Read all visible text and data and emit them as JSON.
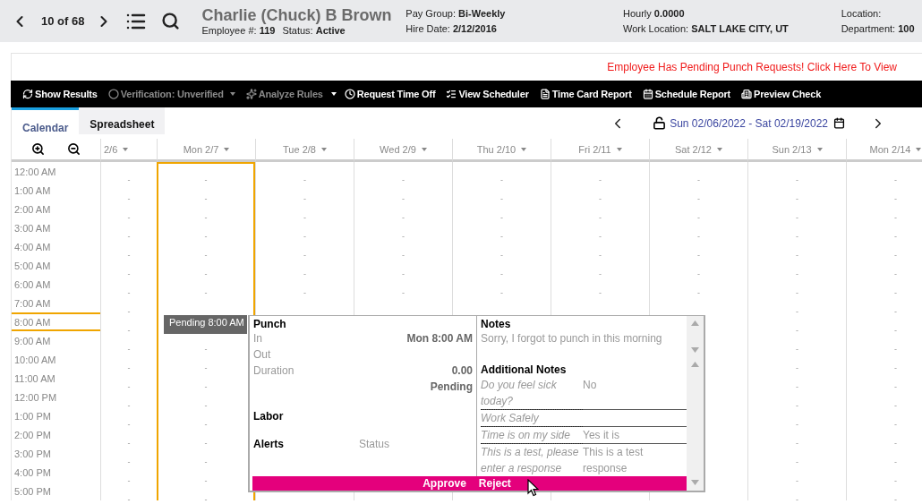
{
  "header": {
    "position": "10 of 68",
    "employee_name": "Charlie (Chuck) B Brown",
    "employee_number_label": "Employee #:",
    "employee_number": "119",
    "status_label": "Status:",
    "status": "Active",
    "field_groups": [
      [
        {
          "label": "Pay Group:",
          "value": "Bi-Weekly"
        },
        {
          "label": "Hire Date:",
          "value": "2/12/2016"
        }
      ],
      [
        {
          "label": "Hourly",
          "value": "0.0000"
        },
        {
          "label": "Work Location:",
          "value": "SALT LAKE CITY, UT"
        }
      ],
      [
        {
          "label": "Location:"
        },
        {
          "label": "Department:",
          "value": "100"
        }
      ]
    ]
  },
  "alert_link": "Employee Has Pending Punch Requests! Click Here To View",
  "toolbar": [
    {
      "kind": "button",
      "label": "Show Results",
      "disabled": false
    },
    {
      "kind": "dropdown",
      "label": "Verification: Unverified",
      "disabled": true
    },
    {
      "kind": "button",
      "label": "Analyze Rules",
      "disabled": true
    },
    {
      "kind": "caret",
      "disabled": false
    },
    {
      "kind": "button",
      "label": "Request Time Off",
      "disabled": false
    },
    {
      "kind": "button",
      "label": "View Scheduler",
      "disabled": false
    },
    {
      "kind": "button",
      "label": "Time Card Report",
      "disabled": false
    },
    {
      "kind": "button",
      "label": "Schedule Report",
      "disabled": false
    },
    {
      "kind": "button",
      "label": "Preview Check",
      "disabled": false
    }
  ],
  "tabs": [
    {
      "label": "Calendar",
      "selected": true
    },
    {
      "label": "Spreadsheet",
      "selected": false
    }
  ],
  "date_range": "Sun 02/06/2022 - Sat 02/19/2022",
  "days": [
    {
      "label": "2/6",
      "selected": false
    },
    {
      "label": "Mon 2/7",
      "selected": true
    },
    {
      "label": "Tue 2/8",
      "selected": false
    },
    {
      "label": "Wed 2/9",
      "selected": false
    },
    {
      "label": "Thu 2/10",
      "selected": false
    },
    {
      "label": "Fri 2/11",
      "selected": false
    },
    {
      "label": "Sat 2/12",
      "selected": false
    },
    {
      "label": "Sun 2/13",
      "selected": false
    },
    {
      "label": "Mon 2/14",
      "selected": false
    }
  ],
  "rows": [
    {
      "time": "12:00 AM",
      "selected": false,
      "cells": [
        "-",
        "-",
        "-",
        "-",
        "-",
        "-",
        "-",
        "-",
        "-"
      ]
    },
    {
      "time": "1:00 AM",
      "selected": false,
      "cells": [
        "-",
        "-",
        "-",
        "-",
        "-",
        "-",
        "-",
        "-",
        "-"
      ]
    },
    {
      "time": "2:00 AM",
      "selected": false,
      "cells": [
        "-",
        "-",
        "-",
        "-",
        "-",
        "-",
        "-",
        "-",
        "-"
      ]
    },
    {
      "time": "3:00 AM",
      "selected": false,
      "cells": [
        "-",
        "-",
        "-",
        "-",
        "-",
        "-",
        "-",
        "-",
        "-"
      ]
    },
    {
      "time": "4:00 AM",
      "selected": false,
      "cells": [
        "-",
        "-",
        "-",
        "-",
        "-",
        "-",
        "-",
        "-",
        "-"
      ]
    },
    {
      "time": "5:00 AM",
      "selected": false,
      "cells": [
        "-",
        "-",
        "-",
        "-",
        "-",
        "-",
        "-",
        "-",
        "-"
      ]
    },
    {
      "time": "6:00 AM",
      "selected": false,
      "cells": [
        "-",
        "-",
        "-",
        "-",
        "-",
        "-",
        "-",
        "-",
        "-"
      ]
    },
    {
      "time": "7:00 AM",
      "selected": false,
      "cells": [
        "-",
        null,
        null,
        null,
        null,
        null,
        null,
        "-",
        "-"
      ]
    },
    {
      "time": "8:00 AM",
      "selected": true,
      "cells": [
        "-",
        null,
        null,
        null,
        null,
        null,
        null,
        "-",
        "-"
      ]
    },
    {
      "time": "9:00 AM",
      "selected": false,
      "cells": [
        "-",
        "-",
        null,
        null,
        null,
        null,
        null,
        "-",
        "-"
      ]
    },
    {
      "time": "10:00 AM",
      "selected": false,
      "cells": [
        "-",
        "-",
        null,
        null,
        null,
        null,
        null,
        "-",
        "-"
      ]
    },
    {
      "time": "11:00 AM",
      "selected": false,
      "cells": [
        "-",
        "-",
        null,
        null,
        null,
        null,
        null,
        "-",
        "-"
      ]
    },
    {
      "time": "12:00 PM",
      "selected": false,
      "cells": [
        "-",
        "-",
        null,
        null,
        null,
        null,
        null,
        "-",
        "-"
      ]
    },
    {
      "time": "1:00 PM",
      "selected": false,
      "cells": [
        "-",
        "-",
        null,
        null,
        null,
        null,
        null,
        "-",
        "-"
      ]
    },
    {
      "time": "2:00 PM",
      "selected": false,
      "cells": [
        "-",
        "-",
        null,
        null,
        null,
        null,
        null,
        "-",
        "-"
      ]
    },
    {
      "time": "3:00 PM",
      "selected": false,
      "cells": [
        "-",
        "-",
        null,
        null,
        null,
        null,
        null,
        "-",
        "-"
      ]
    },
    {
      "time": "4:00 PM",
      "selected": false,
      "cells": [
        "-",
        "-",
        null,
        null,
        null,
        null,
        null,
        "-",
        "-"
      ]
    },
    {
      "time": "5:00 PM",
      "selected": false,
      "cells": [
        "-",
        "-",
        null,
        null,
        null,
        null,
        null,
        "-",
        "-"
      ]
    }
  ],
  "pending_badge": "Pending 8:00 AM",
  "popup": {
    "punch_title": "Punch",
    "punch_rows": [
      {
        "label": "In",
        "value": "Mon 8:00 AM"
      },
      {
        "label": "Out"
      },
      {
        "label": "Duration",
        "value": "0.00"
      }
    ],
    "punch_status": "Pending",
    "labor_title": "Labor",
    "alerts_title": "Alerts",
    "alerts_status": "Status",
    "notes_title": "Notes",
    "notes_text": "Sorry, I forgot to punch in this morning",
    "additional_title": "Additional Notes",
    "additional_notes": [
      {
        "question": "Do you feel sick today?",
        "answer": "No"
      },
      {
        "question": "Work Safely"
      },
      {
        "question": "Time is on my side",
        "answer": "Yes it is"
      },
      {
        "question": "This is a test, please enter a response",
        "answer": "This is a test response"
      }
    ],
    "actions": [
      "Approve",
      "Reject"
    ]
  }
}
